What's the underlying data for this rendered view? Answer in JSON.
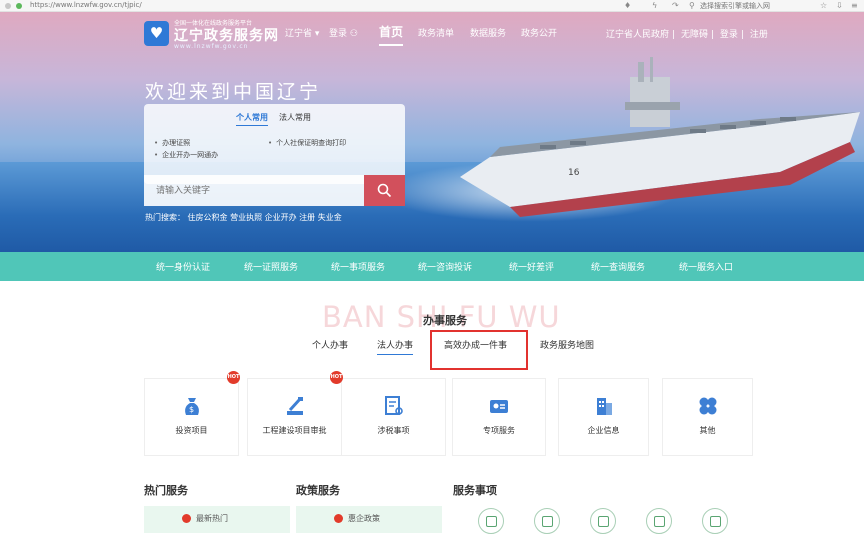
{
  "browser": {
    "url": "https://www.lnzwfw.gov.cn/tjpic/",
    "right_label": "选择搜索引擎或输入网址"
  },
  "header": {
    "logo_sub": "全国一体化在线政务服务平台",
    "logo_main": "辽宁政务服务网",
    "logo_url": "www.lnzwfw.gov.cn",
    "region": "辽宁省",
    "login": "登录",
    "nav": [
      "首页",
      "政务清单",
      "数据服务",
      "政务公开"
    ],
    "right_links": [
      "辽宁省人民政府",
      "无障碍",
      "登录",
      "注册"
    ]
  },
  "hero": {
    "welcome": "欢迎来到中国辽宁",
    "tabs": [
      "个人常用",
      "法人常用"
    ],
    "items": [
      "办理证照",
      "个人社保证明查询打印",
      "企业开办一网通办"
    ],
    "search_placeholder": "请输入关键字",
    "hot_words": "热门搜索：  住房公积金  营业执照  企业开办  注册  失业金"
  },
  "green_nav": [
    "统一身份认证",
    "统一证照服务",
    "统一事项服务",
    "统一咨询投诉",
    "统一好差评",
    "统一查询服务",
    "统一服务入口"
  ],
  "ban_shi": {
    "watermark": "BAN SHI FU WU",
    "title": "办事服务",
    "tabs": [
      "个人办事",
      "法人办事",
      "高效办成一件事",
      "政务服务地图"
    ],
    "cards": [
      {
        "label": "投资项目",
        "icon": "money-bag-icon",
        "hot": true
      },
      {
        "label": "工程建设项目审批",
        "icon": "construction-icon",
        "hot": true
      },
      {
        "label": "涉税事项",
        "icon": "document-search-icon",
        "hot": false
      },
      {
        "label": "专项服务",
        "icon": "id-card-icon",
        "hot": false
      },
      {
        "label": "企业信息",
        "icon": "building-icon",
        "hot": false
      },
      {
        "label": "其他",
        "icon": "grid-icon",
        "hot": false
      }
    ],
    "hot_badge": "HOT"
  },
  "bottom": {
    "hot_services": {
      "title": "热门服务",
      "button": "最新热门"
    },
    "policy_services": {
      "title": "政策服务",
      "button": "惠企政策"
    },
    "service_items": {
      "title": "服务事项",
      "icons": [
        "license-icon",
        "certificate-icon",
        "badge-icon",
        "umbrella-icon",
        "baby-icon"
      ]
    }
  },
  "colors": {
    "accent_green": "#50c6b8",
    "search_button": "#d2505c",
    "highlight_border": "#e2322f",
    "hot_badge": "#e23b2b",
    "brand_blue": "#2f79d6"
  }
}
